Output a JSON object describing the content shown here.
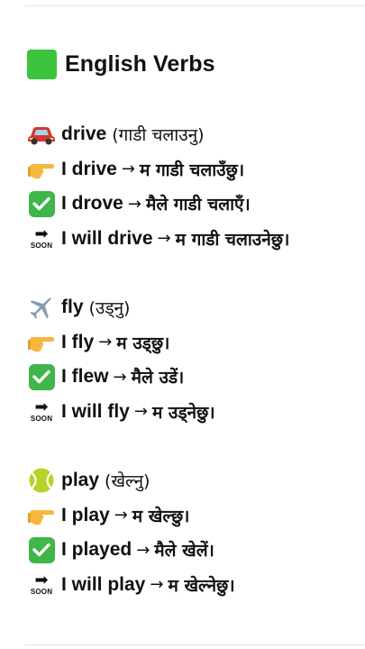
{
  "title": {
    "emoji": "green-square",
    "text": "English Verbs"
  },
  "sections": [
    {
      "icon": "car-icon",
      "verb": "drive",
      "gloss": "(गाडी चलाउनु)",
      "present": {
        "en": "I drive",
        "ne": "म गाडी चलाउँछु।"
      },
      "past": {
        "en": "I drove",
        "ne": "मैले गाडी चलाएँ।"
      },
      "future": {
        "en": "I will drive",
        "ne": "म गाडी चलाउनेछु।"
      }
    },
    {
      "icon": "airplane-icon",
      "verb": "fly",
      "gloss": "(उड्नु)",
      "present": {
        "en": "I fly",
        "ne": "म उड्छु।"
      },
      "past": {
        "en": "I flew",
        "ne": "मैले उडें।"
      },
      "future": {
        "en": "I will fly",
        "ne": "म उड्नेछु।"
      }
    },
    {
      "icon": "tennis-ball-icon",
      "verb": "play",
      "gloss": "(खेल्नु)",
      "present": {
        "en": "I play",
        "ne": "म खेल्छु।"
      },
      "past": {
        "en": "I played",
        "ne": "मैले खेलें।"
      },
      "future": {
        "en": "I will play",
        "ne": "म खेल्नेछु।"
      }
    }
  ],
  "arrow": "→",
  "soon_label": "SOON"
}
